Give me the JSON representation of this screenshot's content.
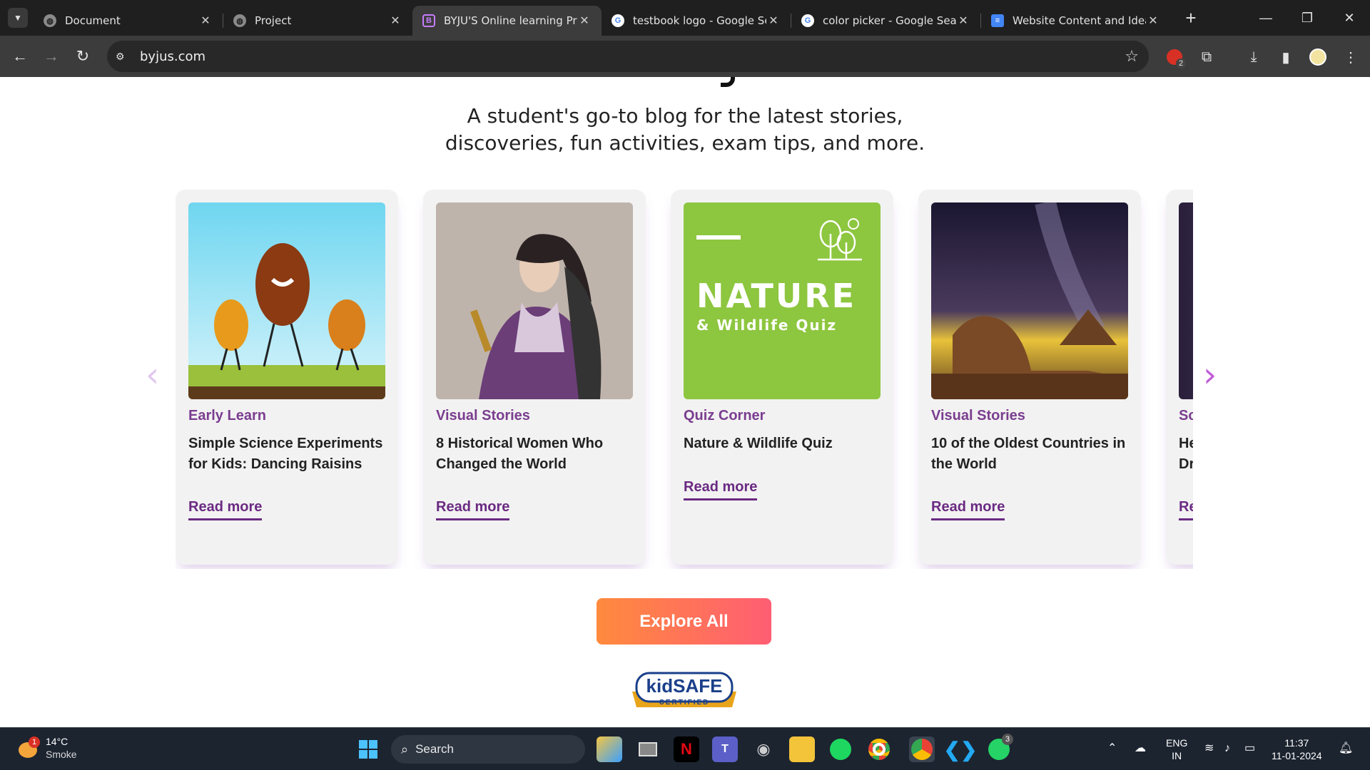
{
  "browser": {
    "tabs": [
      {
        "title": "Document",
        "icon": "globe-icon",
        "active": false
      },
      {
        "title": "Project",
        "icon": "globe-icon",
        "active": false
      },
      {
        "title": "BYJU'S Online learning Pro",
        "icon": "byjus-icon",
        "active": true
      },
      {
        "title": "testbook logo - Google Se",
        "icon": "google-icon",
        "active": false
      },
      {
        "title": "color picker - Google Searc",
        "icon": "google-icon",
        "active": false
      },
      {
        "title": "Website Content and Ideas",
        "icon": "docs-icon",
        "active": false
      }
    ],
    "url": "byjus.com",
    "extension_badge": "2"
  },
  "page": {
    "tagline_line1": "A student's go-to blog for the latest stories,",
    "tagline_line2": "discoveries, fun activities, exam tips, and more.",
    "cards": [
      {
        "category": "Early Learn",
        "title": "Simple Science Experiments for Kids: Dancing Raisins",
        "read_more": "Read more"
      },
      {
        "category": "Visual Stories",
        "title": "8 Historical Women Who Changed the World",
        "read_more": "Read more"
      },
      {
        "category": "Quiz Corner",
        "title": "Nature & Wildlife Quiz",
        "read_more": "Read more",
        "image_title": "NATURE",
        "image_subtitle": "& Wildlife Quiz"
      },
      {
        "category": "Visual Stories",
        "title": "10 of the Oldest Countries in the World",
        "read_more": "Read more"
      },
      {
        "category": "Sc",
        "title": "He Dr",
        "read_more": "Re"
      }
    ],
    "explore_label": "Explore All",
    "badge": {
      "line1": "kidSAFE",
      "line2": "CERTIFIED"
    }
  },
  "taskbar": {
    "weather_temp": "14°C",
    "weather_desc": "Smoke",
    "weather_badge": "1",
    "search_label": "Search",
    "lang1": "ENG",
    "lang2": "IN",
    "time": "11:37",
    "date": "11-01-2024",
    "whatsapp_badge": "3"
  },
  "colors": {
    "accent_purple": "#7a3d8f",
    "explore_start": "#ff8a3d",
    "explore_end": "#ff5e73",
    "quiz_green": "#8dc63f"
  }
}
